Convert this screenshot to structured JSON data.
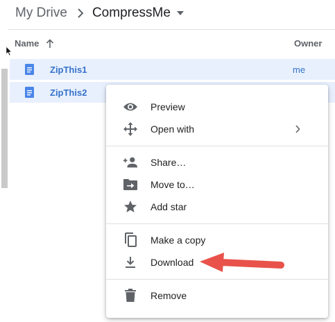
{
  "breadcrumb": {
    "root": "My Drive",
    "current": "CompressMe"
  },
  "columns": {
    "name": "Name",
    "owner": "Owner"
  },
  "files": [
    {
      "name": "ZipThis1",
      "owner": "me"
    },
    {
      "name": "ZipThis2"
    }
  ],
  "context_menu": {
    "preview": "Preview",
    "open_with": "Open with",
    "share": "Share…",
    "move_to": "Move to…",
    "add_star": "Add star",
    "make_copy": "Make a copy",
    "download": "Download",
    "remove": "Remove"
  },
  "colors": {
    "selected_row": "#e8f0fe",
    "file_link": "#3572c8",
    "icon_gray": "#5f6368",
    "doc_blue": "#4a86e8",
    "annotation_arrow": "#e8524a"
  }
}
